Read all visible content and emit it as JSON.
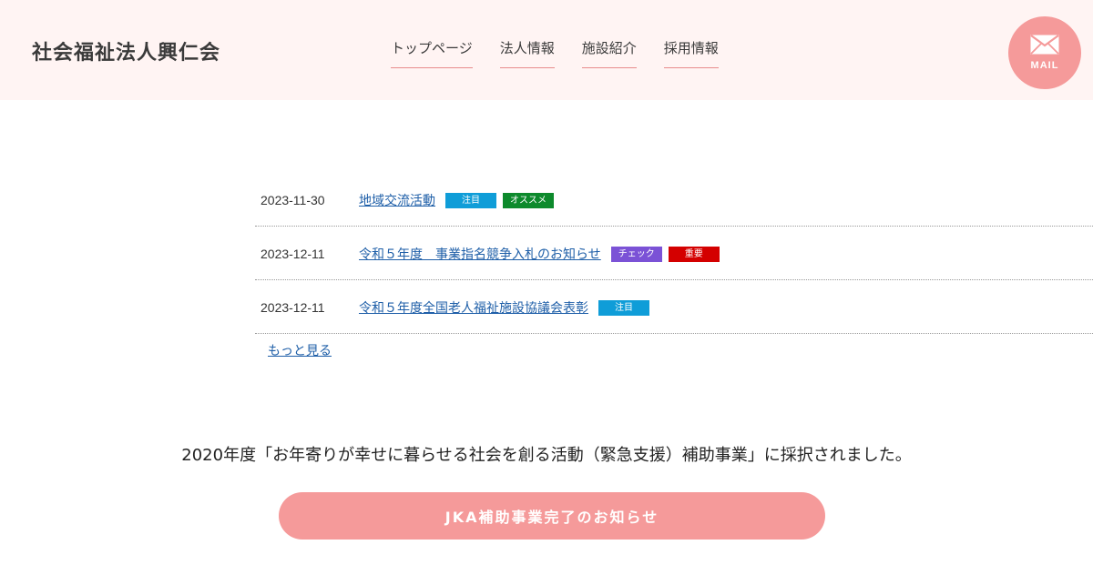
{
  "header": {
    "site_title": "社会福祉法人興仁会",
    "nav": [
      {
        "label": "トップページ"
      },
      {
        "label": "法人情報"
      },
      {
        "label": "施設紹介"
      },
      {
        "label": "採用情報"
      }
    ],
    "mail_label": "MAIL"
  },
  "news": {
    "items": [
      {
        "date": "2023-11-30",
        "title": "地域交流活動",
        "tags": [
          {
            "label": "注目",
            "color": "#0f9dd8"
          },
          {
            "label": "オススメ",
            "color": "#0d8a2c"
          }
        ]
      },
      {
        "date": "2023-12-11",
        "title": "令和５年度　事業指名競争入札のお知らせ",
        "tags": [
          {
            "label": "チェック",
            "color": "#7b52d6"
          },
          {
            "label": "重要",
            "color": "#d40000"
          }
        ]
      },
      {
        "date": "2023-12-11",
        "title": "令和５年度全国老人福祉施設協議会表彰",
        "tags": [
          {
            "label": "注目",
            "color": "#0f9dd8"
          }
        ]
      }
    ],
    "more_label": "もっと見る"
  },
  "notice": {
    "text": "2020年度「お年寄りが幸せに暮らせる社会を創る活動（緊急支援）補助事業」に採択されました。"
  },
  "cta": {
    "label": "JKA補助事業完了のお知らせ"
  },
  "colors": {
    "header_bg": "#fff4f3",
    "accent_pink": "#f59a9a",
    "link_blue": "#1f5fa8"
  }
}
